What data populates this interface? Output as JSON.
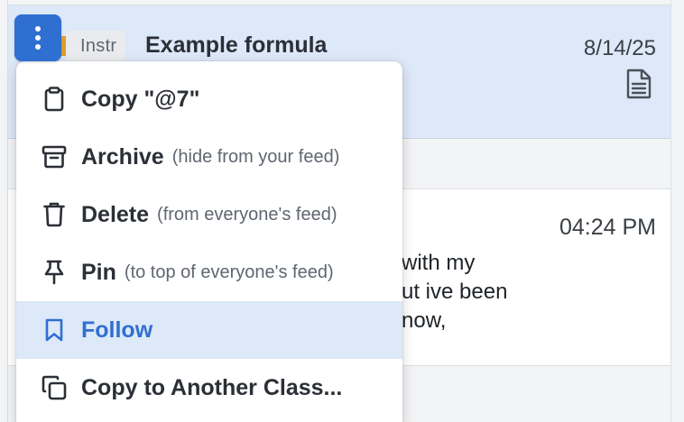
{
  "post_selected": {
    "badge": "Instr",
    "title": "Example formula",
    "date": "8/14/25",
    "attachment_icon": "document-icon"
  },
  "post_second": {
    "time": "04:24 PM",
    "excerpt_lines": [
      "with my",
      "ut ive been",
      "now,"
    ]
  },
  "kebab": {
    "icon": "more-vertical-icon"
  },
  "menu": {
    "items": [
      {
        "label": "Copy \"@7\"",
        "hint": "",
        "icon": "clipboard-icon"
      },
      {
        "label": "Archive",
        "hint": "(hide from your feed)",
        "icon": "archive-icon"
      },
      {
        "label": "Delete",
        "hint": "(from everyone's feed)",
        "icon": "trash-icon"
      },
      {
        "label": "Pin",
        "hint": "(to top of everyone's feed)",
        "icon": "pin-icon"
      },
      {
        "label": "Follow",
        "hint": "",
        "icon": "bookmark-icon",
        "active": true
      },
      {
        "label": "Copy to Another Class...",
        "hint": "",
        "icon": "copy-icon"
      }
    ]
  },
  "colors": {
    "accent": "#2f6fd1",
    "selected_bg": "#dde8f8",
    "badge_stripe": "#e0a02a"
  }
}
